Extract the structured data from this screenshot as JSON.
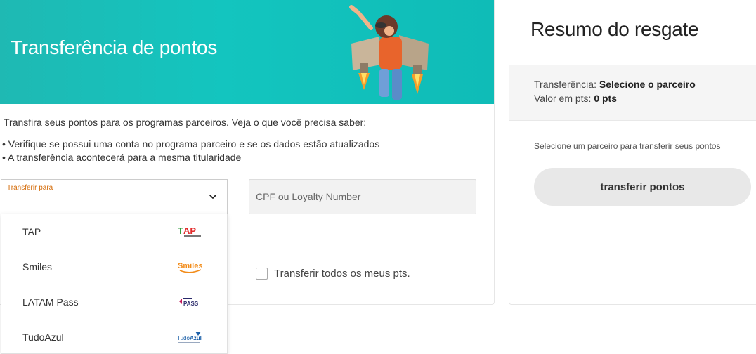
{
  "banner": {
    "title": "Transferência de pontos",
    "color": "#13c5bf"
  },
  "intro": {
    "text": "Transfira seus pontos para os programas parceiros. Veja o que você precisa saber:",
    "bullet1": "• Verifique se possui uma conta no programa parceiro e se os dados estão atualizados",
    "bullet2": "• A transferência acontecerá para a mesma titularidade"
  },
  "form": {
    "partner_select_label": "Transferir para",
    "cpf_placeholder": "CPF ou Loyalty Number",
    "transfer_all_label": "Transferir todos os meus pts.",
    "label_color": "#d46b08"
  },
  "dropdown": {
    "options": [
      {
        "label": "TAP",
        "logo": "tap-logo"
      },
      {
        "label": "Smiles",
        "logo": "smiles-logo"
      },
      {
        "label": "LATAM Pass",
        "logo": "latam-pass-logo"
      },
      {
        "label": "TudoAzul",
        "logo": "tudoazul-logo"
      }
    ]
  },
  "summary": {
    "title": "Resumo do resgate",
    "transfer_label": "Transferência: ",
    "transfer_value": "Selecione o parceiro",
    "points_label": "Valor em pts: ",
    "points_value": "0 pts",
    "helper": "Selecione um parceiro para transferir seus pontos",
    "button_label": "transferir pontos"
  }
}
